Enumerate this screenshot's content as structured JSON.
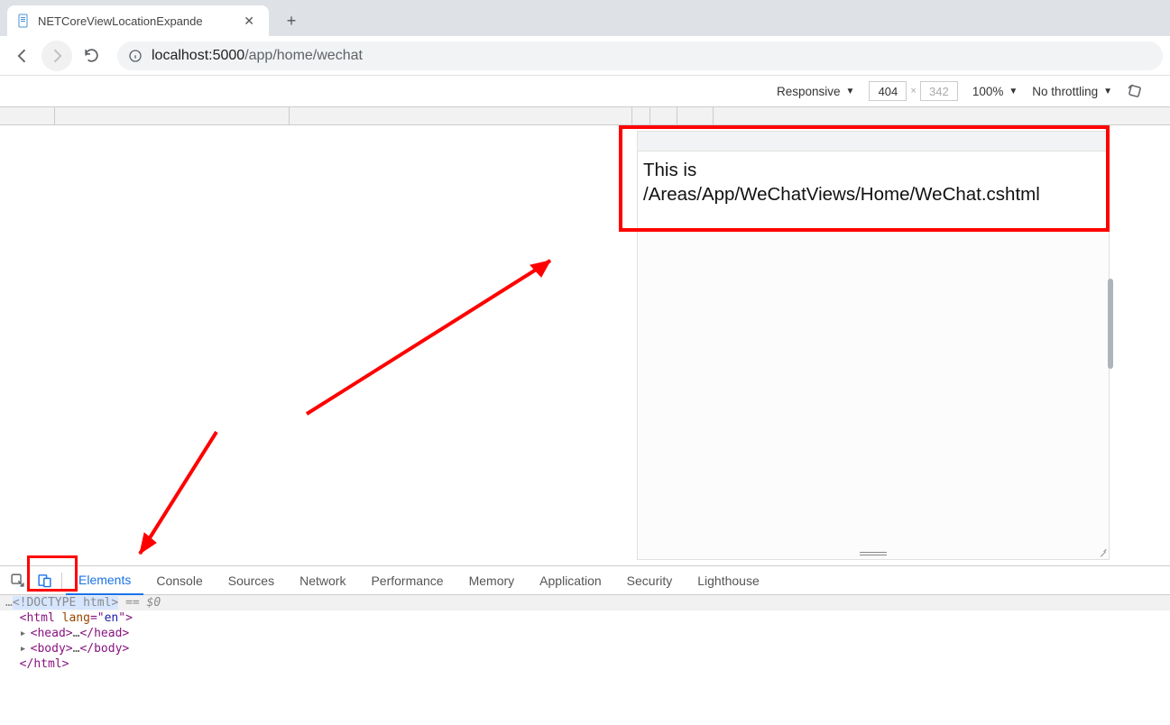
{
  "tab": {
    "title": "NETCoreViewLocationExpande"
  },
  "url": {
    "host": "localhost:",
    "port": "5000",
    "path": "/app/home/wechat"
  },
  "deviceToolbar": {
    "mode": "Responsive",
    "width": "404",
    "height": "342",
    "zoom": "100%",
    "throttling": "No throttling"
  },
  "page": {
    "line1": "This is",
    "line2": "/Areas/App/WeChatViews/Home/WeChat.cshtml"
  },
  "devtools": {
    "tabs": [
      "Elements",
      "Console",
      "Sources",
      "Network",
      "Performance",
      "Memory",
      "Application",
      "Security",
      "Lighthouse"
    ],
    "activeTab": "Elements",
    "dom": {
      "doctype_left": "<",
      "doctype_mid": "!DOCTYPE ",
      "doctype_right": "html>",
      "eq0": " == $0",
      "html_open_a": "<",
      "html_open_b": "html",
      "html_open_c": " lang",
      "html_open_d": "=\"",
      "html_open_e": "en",
      "html_open_f": "\">",
      "head_a": "<",
      "head_b": "head",
      "head_c": ">",
      "head_dots": "…",
      "head_d": "</",
      "head_e": "head",
      "head_f": ">",
      "body_a": "<",
      "body_b": "body",
      "body_c": ">",
      "body_dots": "…",
      "body_d": "</",
      "body_e": "body",
      "body_f": ">",
      "html_close_a": "</",
      "html_close_b": "html",
      "html_close_c": ">"
    }
  }
}
